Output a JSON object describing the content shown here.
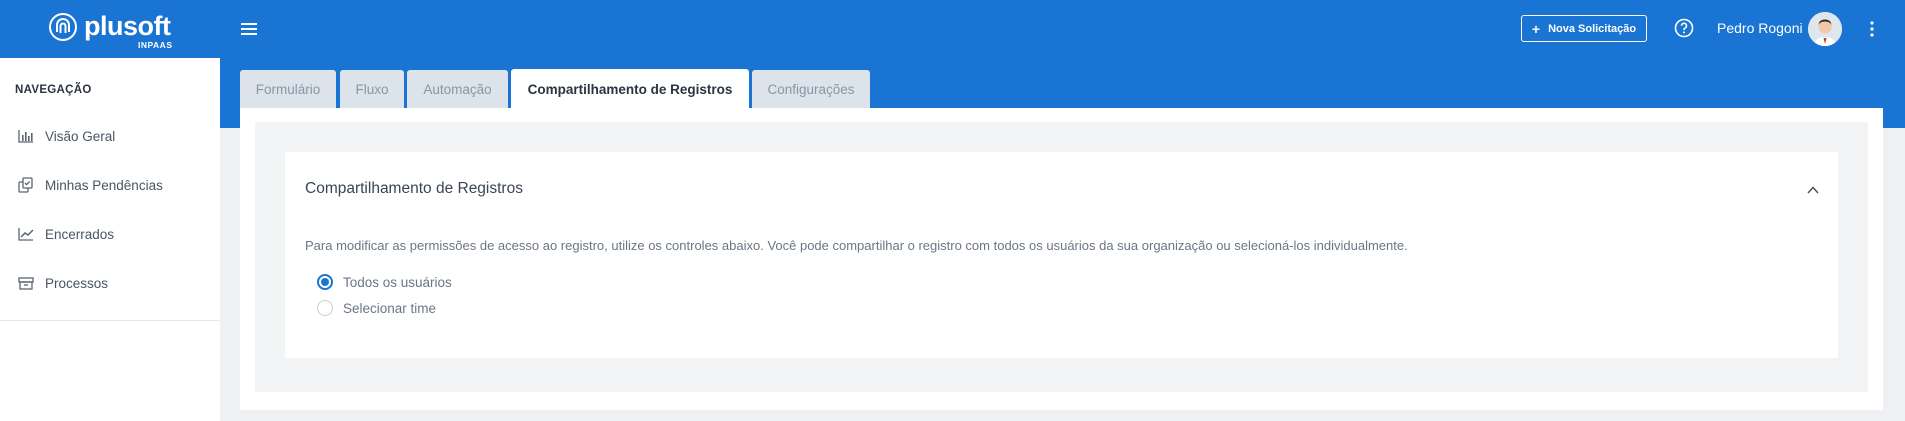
{
  "header": {
    "logo_text": "plusoft",
    "logo_sub": "INPAAS",
    "new_request_label": "Nova Solicitação",
    "user_name": "Pedro Rogoni"
  },
  "sidebar": {
    "title": "NAVEGAÇÃO",
    "items": [
      {
        "label": "Visão Geral",
        "icon": "bar-chart-icon"
      },
      {
        "label": "Minhas Pendências",
        "icon": "tasks-icon"
      },
      {
        "label": "Encerrados",
        "icon": "trend-chart-icon"
      },
      {
        "label": "Processos",
        "icon": "archive-icon"
      }
    ]
  },
  "tabs": [
    {
      "label": "Formulário",
      "active": false
    },
    {
      "label": "Fluxo",
      "active": false
    },
    {
      "label": "Automação",
      "active": false
    },
    {
      "label": "Compartilhamento de Registros",
      "active": true
    },
    {
      "label": "Configurações",
      "active": false
    }
  ],
  "card": {
    "title": "Compartilhamento de Registros",
    "description": "Para modificar as permissões de acesso ao registro, utilize os controles abaixo. Você pode compartilhar o registro com todos os usuários da sua organização ou selecioná-los individualmente.",
    "options": [
      {
        "label": "Todos os usuários",
        "checked": true
      },
      {
        "label": "Selecionar time",
        "checked": false
      }
    ]
  },
  "colors": {
    "primary": "#1a74d3",
    "background": "#eef0f3"
  }
}
